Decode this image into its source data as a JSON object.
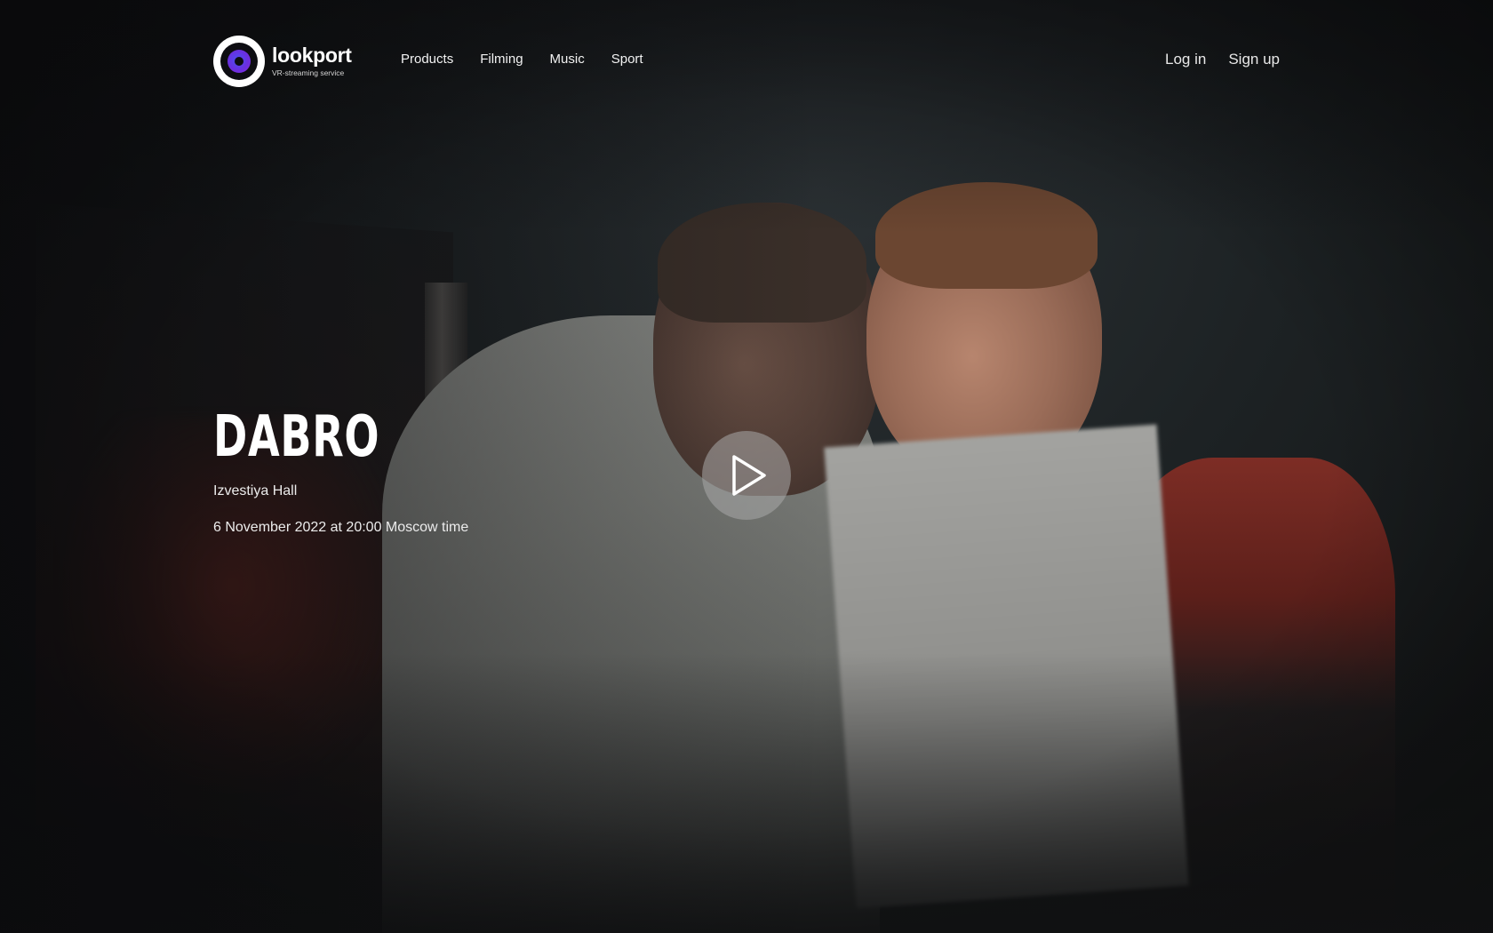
{
  "brand": {
    "name": "lookport",
    "tagline": "VR-streaming service",
    "logo_icon": "eye-lens-icon",
    "accent_color": "#6a2fe0"
  },
  "nav": {
    "items": [
      {
        "label": "Products"
      },
      {
        "label": "Filming"
      },
      {
        "label": "Music"
      },
      {
        "label": "Sport"
      }
    ]
  },
  "auth": {
    "login_label": "Log in",
    "signup_label": "Sign up"
  },
  "event": {
    "title": "DABRO",
    "venue": "Izvestiya Hall",
    "datetime": "6 November 2022 at 20:00 Moscow time"
  },
  "player": {
    "play_icon": "play-icon"
  }
}
